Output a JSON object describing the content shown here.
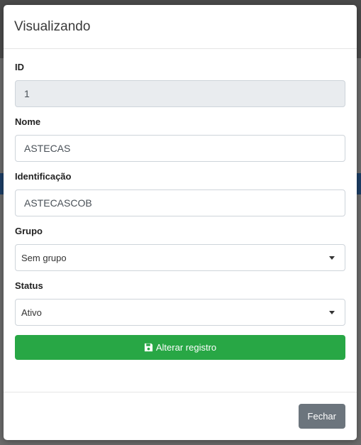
{
  "modal": {
    "title": "Visualizando"
  },
  "form": {
    "id": {
      "label": "ID",
      "value": "1"
    },
    "nome": {
      "label": "Nome",
      "value": "ASTECAS"
    },
    "identificacao": {
      "label": "Identificação",
      "value": "ASTECASCOB"
    },
    "grupo": {
      "label": "Grupo",
      "selected": "Sem grupo"
    },
    "status": {
      "label": "Status",
      "selected": "Ativo"
    },
    "submit_label": "Alterar registro",
    "submit_icon": "save-icon"
  },
  "footer": {
    "close_label": "Fechar"
  },
  "colors": {
    "success": "#28a745",
    "secondary": "#6c757d"
  }
}
